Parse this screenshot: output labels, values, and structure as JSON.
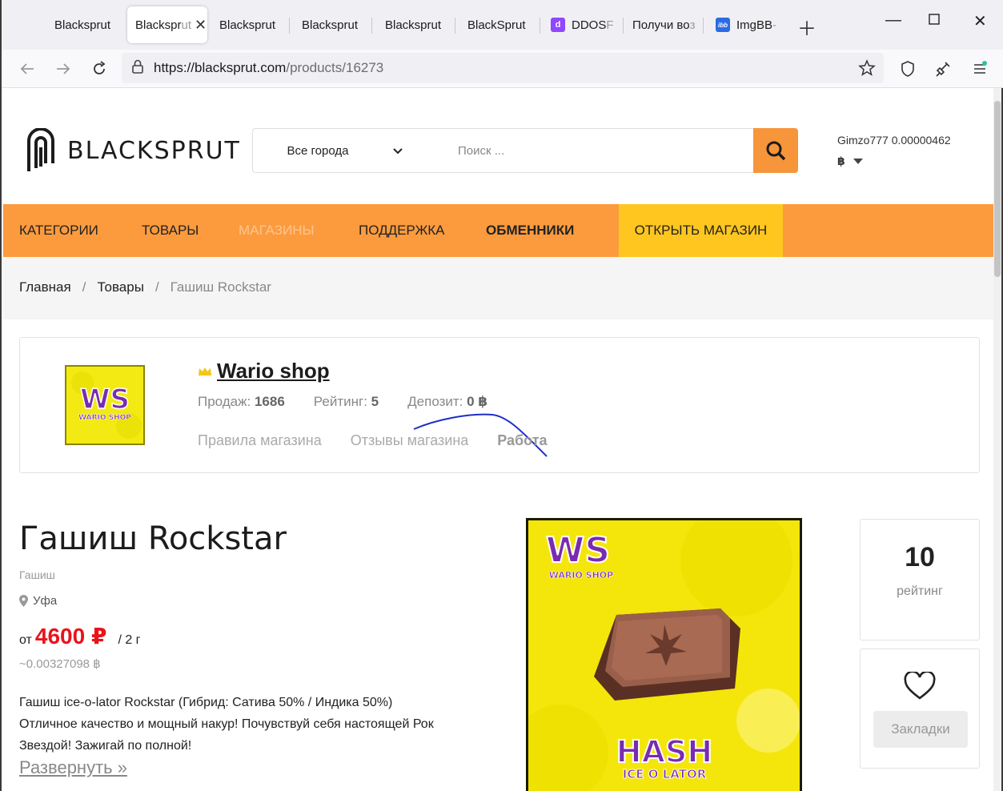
{
  "browser": {
    "tabs": [
      {
        "label": "Blacksprut",
        "fade": ""
      },
      {
        "label": "Blackspr",
        "fade": "ut",
        "active": true
      },
      {
        "label": "Blacksprut",
        "fade": ""
      },
      {
        "label": "Blacksprut",
        "fade": ""
      },
      {
        "label": "Blacksprut",
        "fade": ""
      },
      {
        "label": "BlackSprut",
        "fade": ""
      },
      {
        "label": "DDOS ",
        "fade": "F"
      },
      {
        "label": "Получи во",
        "fade": "з"
      },
      {
        "label": "ImgBB ",
        "fade": "-"
      }
    ],
    "fav_ddos_color": "#9146ff",
    "fav_imgbb_color": "#2b6be6",
    "fav_ddos_glyph": "d",
    "fav_imgbb_glyph": "ibb",
    "url_host": "https://blacksprut.com",
    "url_path": "/products/16273"
  },
  "header": {
    "logo_text": "BLACKSPRUT",
    "city": "Все города",
    "search_placeholder": "Поиск ...",
    "user": "Gimzo777 0.00000462",
    "currency_symbol": "฿"
  },
  "menu": {
    "categories": "КАТЕГОРИИ",
    "products": "ТОВАРЫ",
    "shops": "МАГАЗИНЫ",
    "support": "ПОДДЕРЖКА",
    "exchangers": "ОБМЕННИКИ",
    "open_shop": "ОТКРЫТЬ МАГАЗИН"
  },
  "breadcrumb": {
    "home": "Главная",
    "products": "Товары",
    "current": "Гашиш Rockstar",
    "sep": "/"
  },
  "shop": {
    "name": "Wario shop",
    "logo_text": "WS",
    "logo_sub": "WARIO SHOP",
    "sales_label": "Продаж:",
    "sales": "1686",
    "rating_label": "Рейтинг:",
    "rating": "5",
    "deposit_label": "Депозит:",
    "deposit": "0 ฿",
    "links": {
      "rules": "Правила магазина",
      "reviews": "Отзывы магазина",
      "work": "Работа"
    }
  },
  "product": {
    "title": "Гашиш Rockstar",
    "category": "Гашиш",
    "city": "Уфа",
    "price_from": "от",
    "price": "4600 ₽",
    "per": "/ 2 г",
    "btc": "~0.00327098 ฿",
    "desc_line1": "Гашиш ice-o-lator Rockstar (Гибрид: Сатива 50% / Индика 50%)",
    "desc_line2": "Отличное качество и мощный накур! Почувствуй себя настоящей Рок",
    "desc_line3": "Звездой! Зажигай по полной!",
    "more": "Развернуть »",
    "image_logo": "WS",
    "image_logo_sub": "WARIO SHOP",
    "image_hash": "HASH",
    "image_sub": "ICE O LATOR"
  },
  "rating_box": {
    "value": "10",
    "label": "рейтинг"
  },
  "bookmarks": {
    "label": "Закладки"
  },
  "colors": {
    "accent_orange": "#fb9b3e",
    "accent_yellow": "#fec61e",
    "price_red": "#e8141c"
  }
}
